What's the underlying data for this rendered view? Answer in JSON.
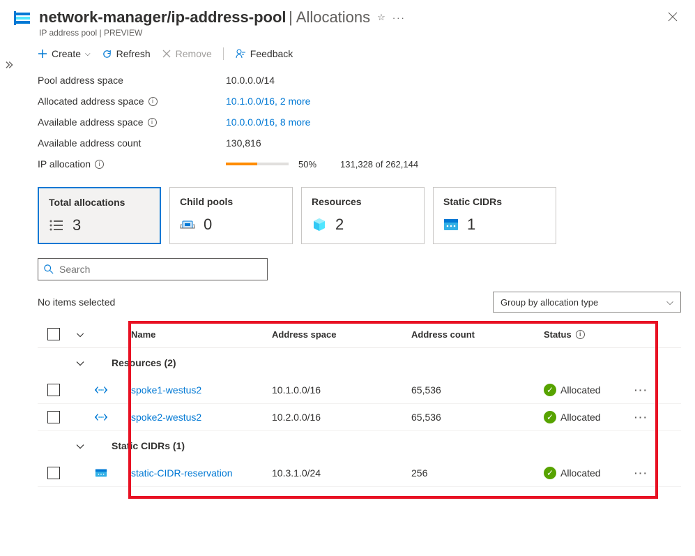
{
  "header": {
    "title_main": "network-manager/ip-address-pool",
    "title_suffix": "Allocations",
    "subtitle": "IP address pool | PREVIEW"
  },
  "toolbar": {
    "create": "Create",
    "refresh": "Refresh",
    "remove": "Remove",
    "feedback": "Feedback"
  },
  "props": {
    "pool_label": "Pool address space",
    "pool_value": "10.0.0.0/14",
    "allocated_label": "Allocated address space",
    "allocated_value": "10.1.0.0/16, 2 more",
    "available_label": "Available address space",
    "available_value": "10.0.0.0/16, 8 more",
    "avail_count_label": "Available address count",
    "avail_count_value": "130,816",
    "ip_alloc_label": "IP allocation",
    "ip_alloc_pct": "50%",
    "ip_alloc_detail": "131,328 of 262,144",
    "ip_alloc_progress": 50
  },
  "cards": {
    "total": {
      "title": "Total allocations",
      "count": "3"
    },
    "child": {
      "title": "Child pools",
      "count": "0"
    },
    "resources": {
      "title": "Resources",
      "count": "2"
    },
    "static": {
      "title": "Static CIDRs",
      "count": "1"
    }
  },
  "search": {
    "placeholder": "Search"
  },
  "list": {
    "no_items": "No items selected",
    "group_by": "Group by allocation type"
  },
  "columns": {
    "name": "Name",
    "addr": "Address space",
    "count": "Address count",
    "status": "Status"
  },
  "groups": {
    "resources": "Resources (2)",
    "static": "Static CIDRs (1)"
  },
  "rows": {
    "r1": {
      "name": "spoke1-westus2",
      "addr": "10.1.0.0/16",
      "count": "65,536",
      "status": "Allocated"
    },
    "r2": {
      "name": "spoke2-westus2",
      "addr": "10.2.0.0/16",
      "count": "65,536",
      "status": "Allocated"
    },
    "s1": {
      "name": "static-CIDR-reservation",
      "addr": "10.3.1.0/24",
      "count": "256",
      "status": "Allocated"
    }
  }
}
